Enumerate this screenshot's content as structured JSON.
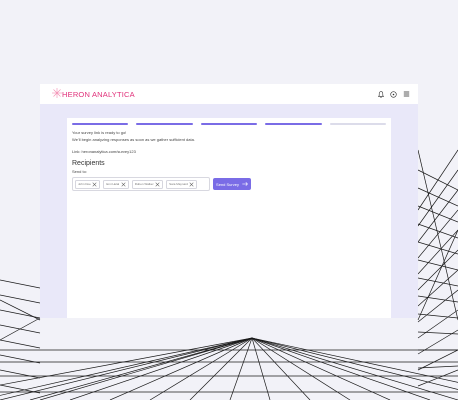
{
  "app": {
    "brand": "HERON ANALYTICA"
  },
  "header": {
    "icons": [
      "bell-icon",
      "help-icon",
      "menu-icon"
    ]
  },
  "progress": {
    "steps_total": 5,
    "steps_completed": 4
  },
  "survey": {
    "ready_text": "Your survey link is ready to go!",
    "analyze_text": "We'll begin analyzing responses as soon as we gather sufficient data.",
    "link_text": "Link: heronanalytica.com/survey123"
  },
  "recipients": {
    "title": "Recipients",
    "send_to_label": "Send to:",
    "chips": [
      "John Doe",
      "Emi Helal",
      "Ruben Walker",
      "Sara Maynard"
    ],
    "send_button": "Send Survey"
  },
  "colors": {
    "accent": "#7a6ce6",
    "brand": "#e0307a"
  }
}
